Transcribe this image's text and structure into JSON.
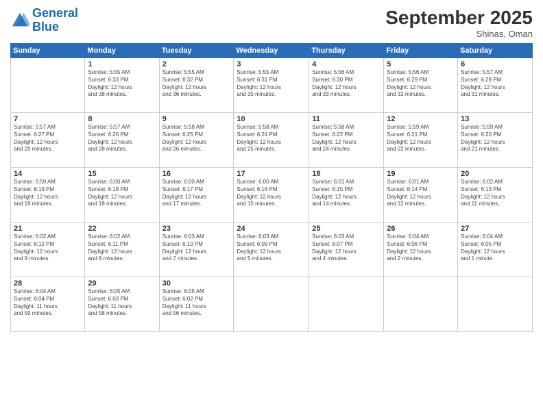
{
  "header": {
    "logo_line1": "General",
    "logo_line2": "Blue",
    "month": "September 2025",
    "location": "Shinas, Oman"
  },
  "weekdays": [
    "Sunday",
    "Monday",
    "Tuesday",
    "Wednesday",
    "Thursday",
    "Friday",
    "Saturday"
  ],
  "weeks": [
    [
      {
        "day": "",
        "info": ""
      },
      {
        "day": "1",
        "info": "Sunrise: 5:55 AM\nSunset: 6:33 PM\nDaylight: 12 hours\nand 38 minutes."
      },
      {
        "day": "2",
        "info": "Sunrise: 5:55 AM\nSunset: 6:32 PM\nDaylight: 12 hours\nand 36 minutes."
      },
      {
        "day": "3",
        "info": "Sunrise: 5:55 AM\nSunset: 6:31 PM\nDaylight: 12 hours\nand 35 minutes."
      },
      {
        "day": "4",
        "info": "Sunrise: 5:56 AM\nSunset: 6:30 PM\nDaylight: 12 hours\nand 33 minutes."
      },
      {
        "day": "5",
        "info": "Sunrise: 5:56 AM\nSunset: 6:29 PM\nDaylight: 12 hours\nand 32 minutes."
      },
      {
        "day": "6",
        "info": "Sunrise: 5:57 AM\nSunset: 6:28 PM\nDaylight: 12 hours\nand 31 minutes."
      }
    ],
    [
      {
        "day": "7",
        "info": "Sunrise: 5:57 AM\nSunset: 6:27 PM\nDaylight: 12 hours\nand 29 minutes."
      },
      {
        "day": "8",
        "info": "Sunrise: 5:57 AM\nSunset: 6:26 PM\nDaylight: 12 hours\nand 28 minutes."
      },
      {
        "day": "9",
        "info": "Sunrise: 5:58 AM\nSunset: 6:25 PM\nDaylight: 12 hours\nand 26 minutes."
      },
      {
        "day": "10",
        "info": "Sunrise: 5:58 AM\nSunset: 6:24 PM\nDaylight: 12 hours\nand 25 minutes."
      },
      {
        "day": "11",
        "info": "Sunrise: 5:58 AM\nSunset: 6:22 PM\nDaylight: 12 hours\nand 24 minutes."
      },
      {
        "day": "12",
        "info": "Sunrise: 5:59 AM\nSunset: 6:21 PM\nDaylight: 12 hours\nand 22 minutes."
      },
      {
        "day": "13",
        "info": "Sunrise: 5:59 AM\nSunset: 6:20 PM\nDaylight: 12 hours\nand 21 minutes."
      }
    ],
    [
      {
        "day": "14",
        "info": "Sunrise: 5:59 AM\nSunset: 6:19 PM\nDaylight: 12 hours\nand 19 minutes."
      },
      {
        "day": "15",
        "info": "Sunrise: 6:00 AM\nSunset: 6:18 PM\nDaylight: 12 hours\nand 18 minutes."
      },
      {
        "day": "16",
        "info": "Sunrise: 6:00 AM\nSunset: 6:17 PM\nDaylight: 12 hours\nand 17 minutes."
      },
      {
        "day": "17",
        "info": "Sunrise: 6:00 AM\nSunset: 6:16 PM\nDaylight: 12 hours\nand 15 minutes."
      },
      {
        "day": "18",
        "info": "Sunrise: 6:01 AM\nSunset: 6:15 PM\nDaylight: 12 hours\nand 14 minutes."
      },
      {
        "day": "19",
        "info": "Sunrise: 6:01 AM\nSunset: 6:14 PM\nDaylight: 12 hours\nand 12 minutes."
      },
      {
        "day": "20",
        "info": "Sunrise: 6:02 AM\nSunset: 6:13 PM\nDaylight: 12 hours\nand 11 minutes."
      }
    ],
    [
      {
        "day": "21",
        "info": "Sunrise: 6:02 AM\nSunset: 6:12 PM\nDaylight: 12 hours\nand 9 minutes."
      },
      {
        "day": "22",
        "info": "Sunrise: 6:02 AM\nSunset: 6:11 PM\nDaylight: 12 hours\nand 8 minutes."
      },
      {
        "day": "23",
        "info": "Sunrise: 6:03 AM\nSunset: 6:10 PM\nDaylight: 12 hours\nand 7 minutes."
      },
      {
        "day": "24",
        "info": "Sunrise: 6:03 AM\nSunset: 6:09 PM\nDaylight: 12 hours\nand 5 minutes."
      },
      {
        "day": "25",
        "info": "Sunrise: 6:03 AM\nSunset: 6:07 PM\nDaylight: 12 hours\nand 4 minutes."
      },
      {
        "day": "26",
        "info": "Sunrise: 6:04 AM\nSunset: 6:06 PM\nDaylight: 12 hours\nand 2 minutes."
      },
      {
        "day": "27",
        "info": "Sunrise: 6:04 AM\nSunset: 6:05 PM\nDaylight: 12 hours\nand 1 minute."
      }
    ],
    [
      {
        "day": "28",
        "info": "Sunrise: 6:04 AM\nSunset: 6:04 PM\nDaylight: 11 hours\nand 59 minutes."
      },
      {
        "day": "29",
        "info": "Sunrise: 6:05 AM\nSunset: 6:03 PM\nDaylight: 11 hours\nand 58 minutes."
      },
      {
        "day": "30",
        "info": "Sunrise: 6:05 AM\nSunset: 6:02 PM\nDaylight: 11 hours\nand 56 minutes."
      },
      {
        "day": "",
        "info": ""
      },
      {
        "day": "",
        "info": ""
      },
      {
        "day": "",
        "info": ""
      },
      {
        "day": "",
        "info": ""
      }
    ]
  ]
}
